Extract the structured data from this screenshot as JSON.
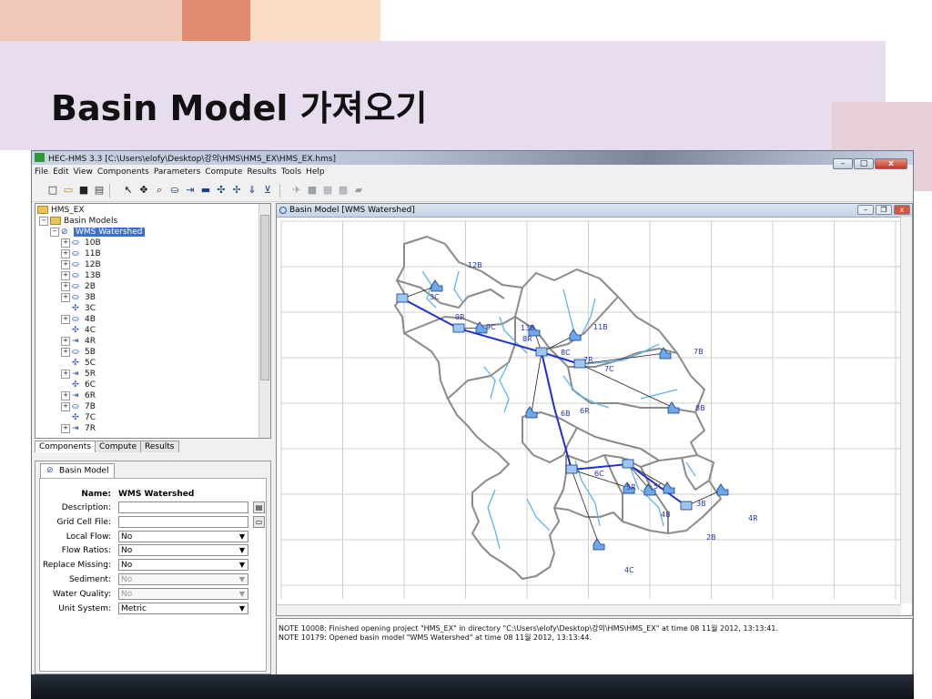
{
  "slide": {
    "title": "Basin Model 가져오기"
  },
  "window": {
    "title": "HEC-HMS 3.3 [C:\\Users\\elofy\\Desktop\\강의\\HMS\\HMS_EX\\HMS_EX.hms]"
  },
  "menu": [
    "File",
    "Edit",
    "View",
    "Components",
    "Parameters",
    "Compute",
    "Results",
    "Tools",
    "Help"
  ],
  "tree": {
    "root": "HMS_EX",
    "basin_models": "Basin Models",
    "selected": "WMS Watershed",
    "items": [
      "10B",
      "11B",
      "12B",
      "13B",
      "2B",
      "3B",
      "3C",
      "4B",
      "4C",
      "4R",
      "5B",
      "5C",
      "5R",
      "6C",
      "6R",
      "7B",
      "7C",
      "7R"
    ]
  },
  "tabs": [
    "Components",
    "Compute",
    "Results"
  ],
  "props": {
    "tab": "Basin Model",
    "name_label": "Name:",
    "name_value": "WMS Watershed",
    "description_label": "Description:",
    "grid_cell_label": "Grid Cell File:",
    "local_flow_label": "Local Flow:",
    "local_flow_value": "No",
    "flow_ratios_label": "Flow Ratios:",
    "flow_ratios_value": "No",
    "replace_missing_label": "Replace Missing:",
    "replace_missing_value": "No",
    "sediment_label": "Sediment:",
    "sediment_value": "No",
    "water_quality_label": "Water Quality:",
    "water_quality_value": "No",
    "unit_system_label": "Unit System:",
    "unit_system_value": "Metric"
  },
  "basin_window": {
    "title": "Basin Model [WMS Watershed]"
  },
  "map_labels": [
    "12B",
    "3C",
    "9R",
    "9C",
    "13B",
    "11B",
    "8R",
    "8C",
    "7R",
    "7B",
    "7C",
    "8B",
    "6B",
    "6R",
    "6C",
    "5R",
    "5C",
    "3B",
    "4B",
    "4R",
    "2B",
    "4C",
    "5B"
  ],
  "messages": [
    "NOTE 10008:  Finished opening project \"HMS_EX\" in directory \"C:\\Users\\elofy\\Desktop\\강의\\HMS\\HMS_EX\" at time 08 11월 2012, 13:13:41.",
    "NOTE 10179:  Opened basin model \"WMS Watershed\" at time 08 11월 2012, 13:13:44."
  ],
  "colors": {
    "deco_band": "#e8ddef",
    "reach": "#1f2fd0",
    "stream": "#5fb4e6",
    "boundary": "#8a8a8a"
  }
}
